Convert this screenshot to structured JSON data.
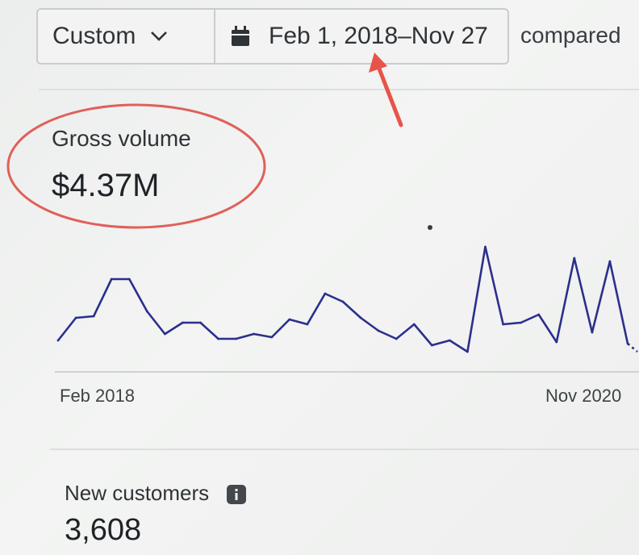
{
  "toolbar": {
    "range_preset": "Custom",
    "date_range": "Feb 1, 2018–Nov 27",
    "compare_label": "compared",
    "icons": {
      "dropdown": "chevron-down-icon",
      "calendar": "calendar-icon"
    }
  },
  "gross_volume": {
    "label": "Gross volume",
    "value": "$4.37M"
  },
  "chart": {
    "x_start_label": "Feb 2018",
    "x_end_label": "Nov 2020",
    "line_color": "#2b2f8c"
  },
  "new_customers": {
    "label": "New customers",
    "value": "3,608",
    "info_icon": "info-icon"
  },
  "chart_data": {
    "type": "line",
    "x_tick_labels": [
      "Feb 2018",
      "Nov 2020"
    ],
    "series": [
      {
        "values": [
          14,
          28,
          29,
          52,
          52,
          32,
          18,
          25,
          25,
          15,
          15,
          18,
          16,
          27,
          24,
          43,
          38,
          28,
          20,
          15,
          24,
          11,
          14,
          7,
          72,
          24,
          25,
          30,
          13,
          65,
          19,
          63,
          12
        ]
      }
    ],
    "ylim": [
      0,
      75
    ],
    "grid": false
  }
}
